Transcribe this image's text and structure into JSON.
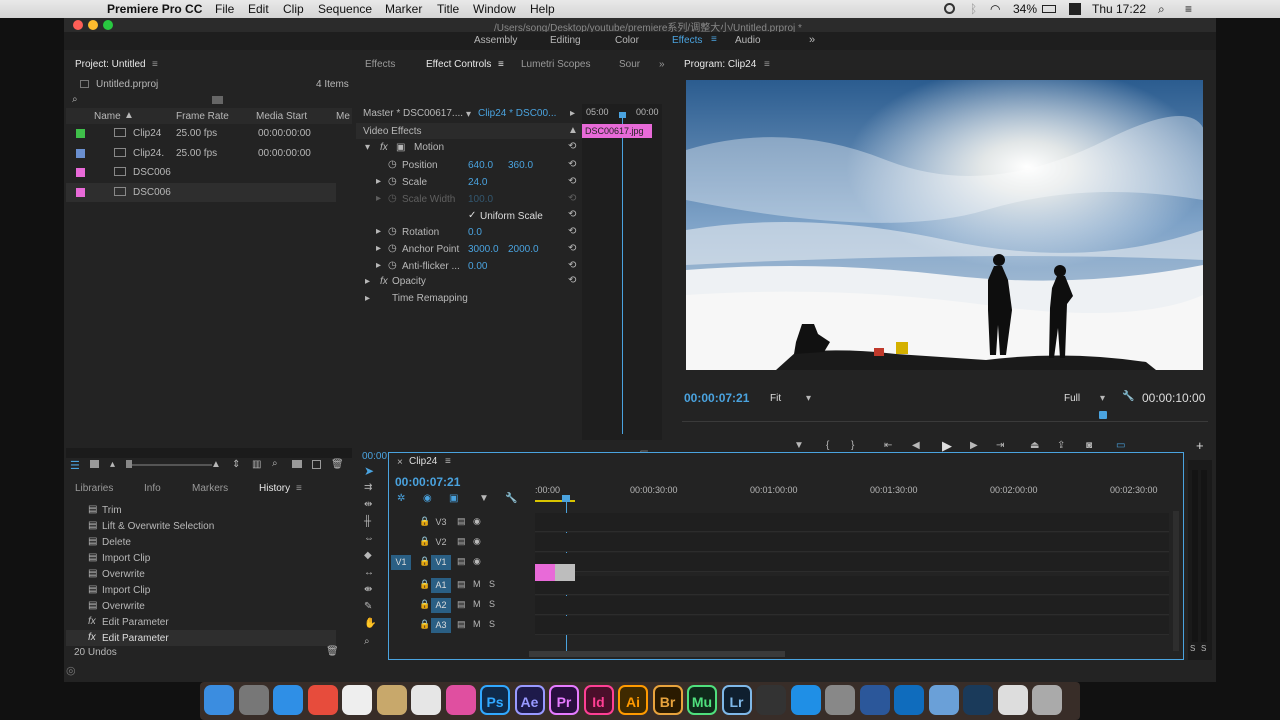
{
  "menubar": {
    "apple": "",
    "app": "Premiere Pro CC",
    "items": [
      "File",
      "Edit",
      "Clip",
      "Sequence",
      "Marker",
      "Title",
      "Window",
      "Help"
    ],
    "battery": "34%",
    "time": "Thu 17:22"
  },
  "window": {
    "path": "/Users/song/Desktop/youtube/premiere系列/调整大小/Untitled.prproj *"
  },
  "workspaces": {
    "items": [
      "Assembly",
      "Editing",
      "Color",
      "Effects",
      "Audio"
    ],
    "active": "Effects",
    "more": "»"
  },
  "project": {
    "tab": "Project: Untitled",
    "file": "Untitled.prproj",
    "count": "4 Items",
    "columns": [
      "Name",
      "Frame Rate",
      "Media Start",
      "Me"
    ],
    "rows": [
      {
        "name": "Clip24",
        "fps": "25.00 fps",
        "start": "00:00:00:00",
        "color": "#3fbf4a"
      },
      {
        "name": "Clip24.",
        "fps": "25.00 fps",
        "start": "00:00:00:00",
        "color": "#6a8fcf"
      },
      {
        "name": "DSC006",
        "fps": "",
        "start": "",
        "color": "#e86ad8"
      },
      {
        "name": "DSC006",
        "fps": "",
        "start": "",
        "color": "#e86ad8"
      }
    ]
  },
  "history": {
    "tabs": [
      "Libraries",
      "Info",
      "Markers",
      "History"
    ],
    "active": "History",
    "items": [
      "Trim",
      "Lift & Overwrite Selection",
      "Delete",
      "Import Clip",
      "Overwrite",
      "Import Clip",
      "Overwrite",
      "Edit Parameter",
      "Edit Parameter"
    ],
    "undos": "20 Undos"
  },
  "effects": {
    "tabs": [
      "Effects",
      "Effect Controls",
      "Lumetri Scopes",
      "Sour"
    ],
    "active": "Effect Controls",
    "master": "Master * DSC00617....",
    "clip": "Clip24 * DSC00...",
    "section": "Video Effects",
    "tc_start": "05:00",
    "tc_end": "00:00",
    "clip_label": "DSC00617.jpg",
    "motion": "Motion",
    "params": [
      {
        "name": "Position",
        "v1": "640.0",
        "v2": "360.0"
      },
      {
        "name": "Scale",
        "v1": "24.0",
        "v2": ""
      },
      {
        "name": "Scale Width",
        "v1": "100.0",
        "v2": ""
      },
      {
        "name": "Rotation",
        "v1": "0.0",
        "v2": ""
      },
      {
        "name": "Anchor Point",
        "v1": "3000.0",
        "v2": "2000.0"
      },
      {
        "name": "Anti-flicker ...",
        "v1": "0.00",
        "v2": ""
      }
    ],
    "uniform": "Uniform Scale",
    "opacity": "Opacity",
    "remap": "Time Remapping",
    "timecode": "00:00:07:21"
  },
  "program": {
    "title": "Program: Clip24",
    "timecode": "00:00:07:21",
    "fit": "Fit",
    "quality": "Full",
    "duration": "00:00:10:00",
    "playhead_fraction": 0.8
  },
  "timeline": {
    "tab": "Clip24",
    "timecode": "00:00:07:21",
    "ruler": [
      ":00:00",
      "00:00:30:00",
      "00:01:00:00",
      "00:01:30:00",
      "00:02:00:00",
      "00:02:30:00"
    ],
    "tracks": [
      {
        "id": "V3",
        "src": ""
      },
      {
        "id": "V2",
        "src": ""
      },
      {
        "id": "V1",
        "src": "V1"
      },
      {
        "id": "A1",
        "src": ""
      },
      {
        "id": "A2",
        "src": ""
      },
      {
        "id": "A3",
        "src": ""
      }
    ]
  },
  "dock": [
    "Finder",
    "Launchpad",
    "Safari",
    "Chrome",
    "Calendar",
    "Preview",
    "Photos",
    "iTunes",
    "Ps",
    "Ae",
    "Pr",
    "Id",
    "Ai",
    "Br",
    "Mu",
    "Lr",
    "Final Cut",
    "App Store",
    "System Preferences",
    "Word",
    "Outlook",
    "Migration",
    "QuickTime",
    "User",
    "Trash"
  ],
  "colors": {
    "accent": "#4aa3df",
    "panel": "#232323",
    "pink": "#e86ad8"
  }
}
